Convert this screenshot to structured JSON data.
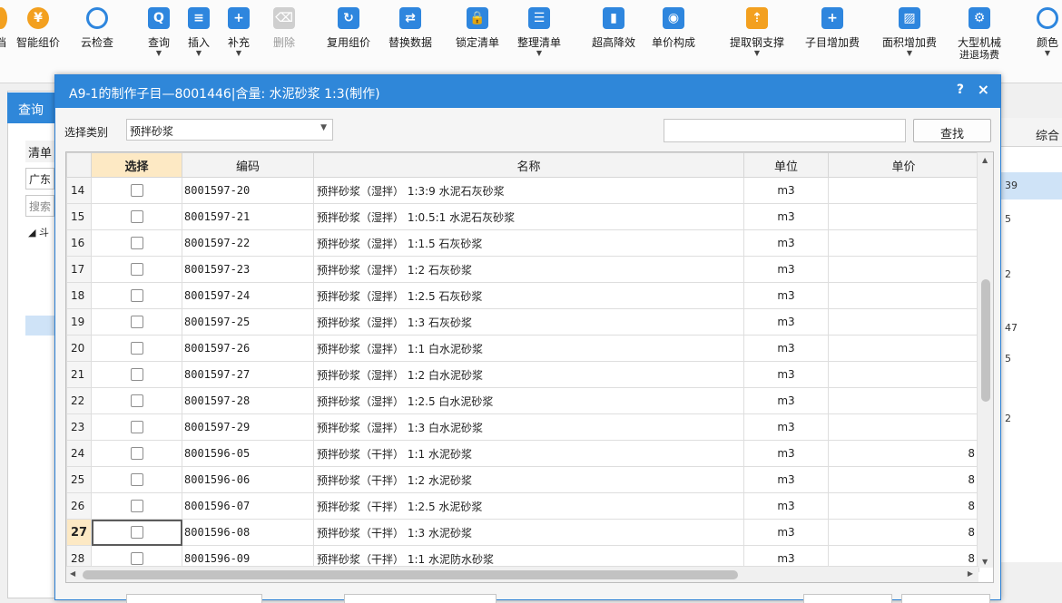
{
  "toolbar": {
    "items": [
      {
        "label": "档",
        "icon": "doc-icon"
      },
      {
        "label": "智能组价",
        "icon": "smart-price-icon"
      },
      {
        "label": "云检查",
        "icon": "cloud-check-icon"
      },
      {
        "label": "查询",
        "icon": "query-icon"
      },
      {
        "label": "插入",
        "icon": "insert-icon"
      },
      {
        "label": "补充",
        "icon": "supplement-icon"
      },
      {
        "label": "删除",
        "icon": "delete-icon"
      },
      {
        "label": "复用组价",
        "icon": "reuse-price-icon"
      },
      {
        "label": "替换数据",
        "icon": "replace-data-icon"
      },
      {
        "label": "锁定清单",
        "icon": "lock-list-icon"
      },
      {
        "label": "整理清单",
        "icon": "organize-list-icon"
      },
      {
        "label": "超高降效",
        "icon": "high-rise-icon"
      },
      {
        "label": "单价构成",
        "icon": "unit-price-icon"
      },
      {
        "label": "提取钢支撑",
        "icon": "steel-support-icon"
      },
      {
        "label": "子目增加费",
        "icon": "sub-item-fee-icon"
      },
      {
        "label": "面积增加费",
        "icon": "area-fee-icon"
      },
      {
        "label": "大型机械",
        "icon": "machinery-icon"
      },
      {
        "label": "颜色",
        "icon": "color-icon"
      }
    ],
    "machinery_sub": "进退场费"
  },
  "background": {
    "query_tab": "查询",
    "list_label": "清单",
    "region": "广东",
    "search": "搜索",
    "tree_arrow": "◢ 斗",
    "right_header": "综合",
    "right_values": [
      "39",
      "5",
      "2",
      "47",
      "5",
      "2"
    ]
  },
  "dialog": {
    "title": "A9-1的制作子目—8001446|含量: 水泥砂浆 1:3(制作)",
    "help": "?",
    "close": "×",
    "category_label": "选择类别",
    "category_value": "预拌砂浆",
    "search_value": "",
    "find_button": "查找",
    "columns": {
      "select": "选择",
      "code": "编码",
      "name": "名称",
      "unit": "单位",
      "price": "单价"
    },
    "rows": [
      {
        "n": "14",
        "code": "8001597-20",
        "name": "预拌砂浆（湿拌） 1:3:9 水泥石灰砂浆",
        "unit": "m3",
        "price": ""
      },
      {
        "n": "15",
        "code": "8001597-21",
        "name": "预拌砂浆（湿拌） 1:0.5:1 水泥石灰砂浆",
        "unit": "m3",
        "price": ""
      },
      {
        "n": "16",
        "code": "8001597-22",
        "name": "预拌砂浆（湿拌） 1:1.5 石灰砂浆",
        "unit": "m3",
        "price": ""
      },
      {
        "n": "17",
        "code": "8001597-23",
        "name": "预拌砂浆（湿拌） 1:2 石灰砂浆",
        "unit": "m3",
        "price": ""
      },
      {
        "n": "18",
        "code": "8001597-24",
        "name": "预拌砂浆（湿拌） 1:2.5 石灰砂浆",
        "unit": "m3",
        "price": ""
      },
      {
        "n": "19",
        "code": "8001597-25",
        "name": "预拌砂浆（湿拌） 1:3 石灰砂浆",
        "unit": "m3",
        "price": ""
      },
      {
        "n": "20",
        "code": "8001597-26",
        "name": "预拌砂浆（湿拌） 1:1 白水泥砂浆",
        "unit": "m3",
        "price": ""
      },
      {
        "n": "21",
        "code": "8001597-27",
        "name": "预拌砂浆（湿拌） 1:2 白水泥砂浆",
        "unit": "m3",
        "price": ""
      },
      {
        "n": "22",
        "code": "8001597-28",
        "name": "预拌砂浆（湿拌） 1:2.5 白水泥砂浆",
        "unit": "m3",
        "price": ""
      },
      {
        "n": "23",
        "code": "8001597-29",
        "name": "预拌砂浆（湿拌） 1:3 白水泥砂浆",
        "unit": "m3",
        "price": ""
      },
      {
        "n": "24",
        "code": "8001596-05",
        "name": "预拌砂浆（干拌） 1:1 水泥砂浆",
        "unit": "m3",
        "price": "8"
      },
      {
        "n": "25",
        "code": "8001596-06",
        "name": "预拌砂浆（干拌） 1:2 水泥砂浆",
        "unit": "m3",
        "price": "8"
      },
      {
        "n": "26",
        "code": "8001596-07",
        "name": "预拌砂浆（干拌） 1:2.5 水泥砂浆",
        "unit": "m3",
        "price": "8"
      },
      {
        "n": "27",
        "code": "8001596-08",
        "name": "预拌砂浆（干拌） 1:3 水泥砂浆",
        "unit": "m3",
        "price": "8",
        "current": true
      },
      {
        "n": "28",
        "code": "8001596-09",
        "name": "预拌砂浆（干拌） 1:1 水泥防水砂浆",
        "unit": "m3",
        "price": "8"
      }
    ]
  },
  "colors": {
    "accent": "#2f87d9",
    "selected_header": "#fde9c4",
    "selection_blue": "#cfe3f7"
  }
}
